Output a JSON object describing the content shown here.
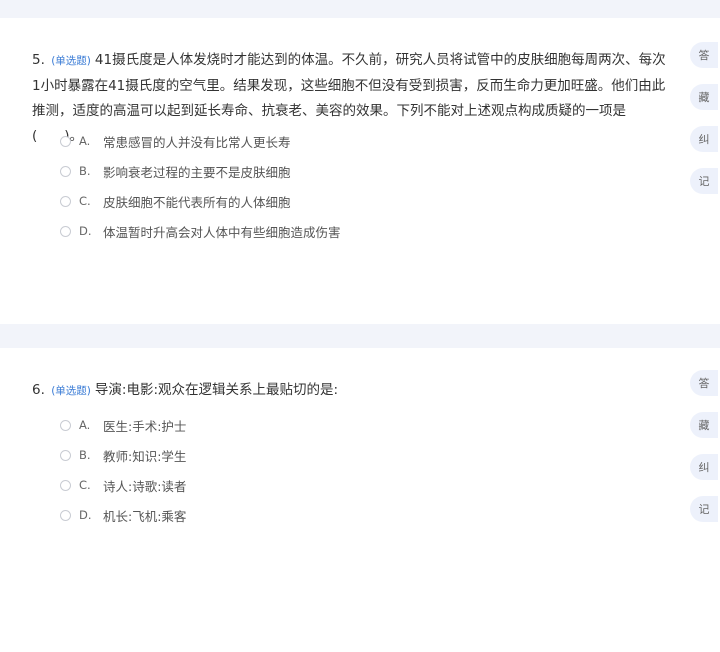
{
  "questions": [
    {
      "number": "5.",
      "type_label": "(单选题)",
      "text": "41摄氏度是人体发烧时才能达到的体温。不久前，研究人员将试管中的皮肤细胞每周两次、每次1小时暴露在41摄氏度的空气里。结果发现，这些细胞不但没有受到损害，反而生命力更加旺盛。他们由此推测，适度的高温可以起到延长寿命、抗衰老、美容的效果。下列不能对上述观点构成质疑的一项是(　　)。",
      "options": [
        {
          "letter": "A.",
          "text": "常患感冒的人并没有比常人更长寿"
        },
        {
          "letter": "B.",
          "text": "影响衰老过程的主要不是皮肤细胞"
        },
        {
          "letter": "C.",
          "text": "皮肤细胞不能代表所有的人体细胞"
        },
        {
          "letter": "D.",
          "text": "体温暂时升高会对人体中有些细胞造成伤害"
        }
      ]
    },
    {
      "number": "6.",
      "type_label": "(单选题)",
      "text": "导演:电影:观众在逻辑关系上最贴切的是:",
      "options": [
        {
          "letter": "A.",
          "text": "医生:手术:护士"
        },
        {
          "letter": "B.",
          "text": "教师:知识:学生"
        },
        {
          "letter": "C.",
          "text": "诗人:诗歌:读者"
        },
        {
          "letter": "D.",
          "text": "机长:飞机:乘客"
        }
      ]
    }
  ],
  "side_tools": [
    "答",
    "藏",
    "纠",
    "记"
  ],
  "colors": {
    "background": "#f2f4fa",
    "card": "#ffffff",
    "type_label": "#3a7bd5",
    "tool_button": "#edf1fb"
  }
}
